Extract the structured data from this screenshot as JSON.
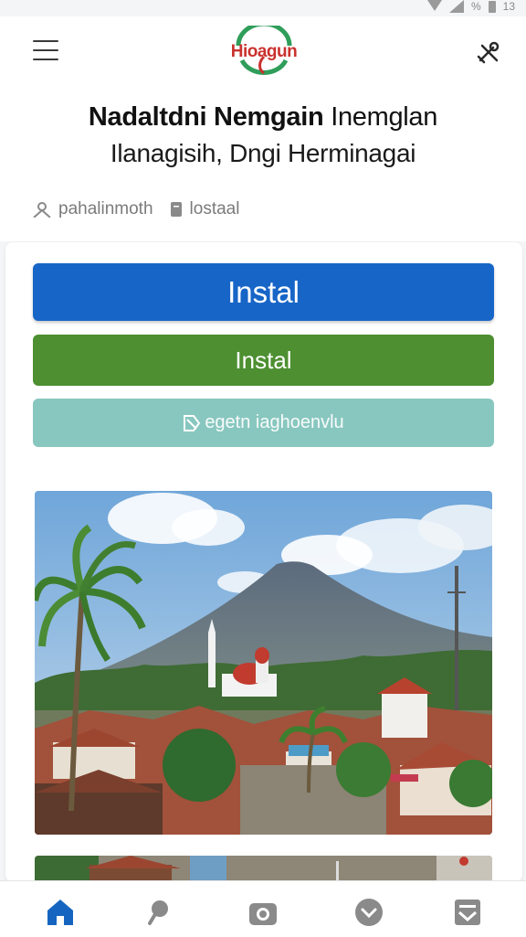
{
  "status_bar": {
    "battery_text": "13",
    "signal_text": "%"
  },
  "header": {
    "logo_text": "Hioagun",
    "title_line1_bold": "Nadaltdni Nemgain",
    "title_line1_rest": " Inemglan",
    "title_line2": "Ilanagisih, Dngi Herminagai",
    "meta": [
      {
        "icon": "user-icon",
        "label": "pahalinmoth"
      },
      {
        "icon": "document-icon",
        "label": "lostaal"
      }
    ]
  },
  "actions": {
    "primary_label": "Instal",
    "secondary_label": "Instal",
    "tertiary_label": "egetn iaghoenvlu",
    "tertiary_icon": "tag-icon"
  },
  "bottom_nav": [
    {
      "icon": "home-icon",
      "active": true
    },
    {
      "icon": "search-icon",
      "active": false
    },
    {
      "icon": "camera-icon",
      "active": false
    },
    {
      "icon": "heart-icon",
      "active": false
    },
    {
      "icon": "inbox-icon",
      "active": false
    }
  ],
  "colors": {
    "primary": "#1765c7",
    "green": "#4d8f31",
    "teal": "#88c7bf",
    "logo_red": "#c9322f",
    "logo_green": "#2f9e5a",
    "nav_active": "#1565c0",
    "nav_inactive": "#8a8a8a"
  }
}
